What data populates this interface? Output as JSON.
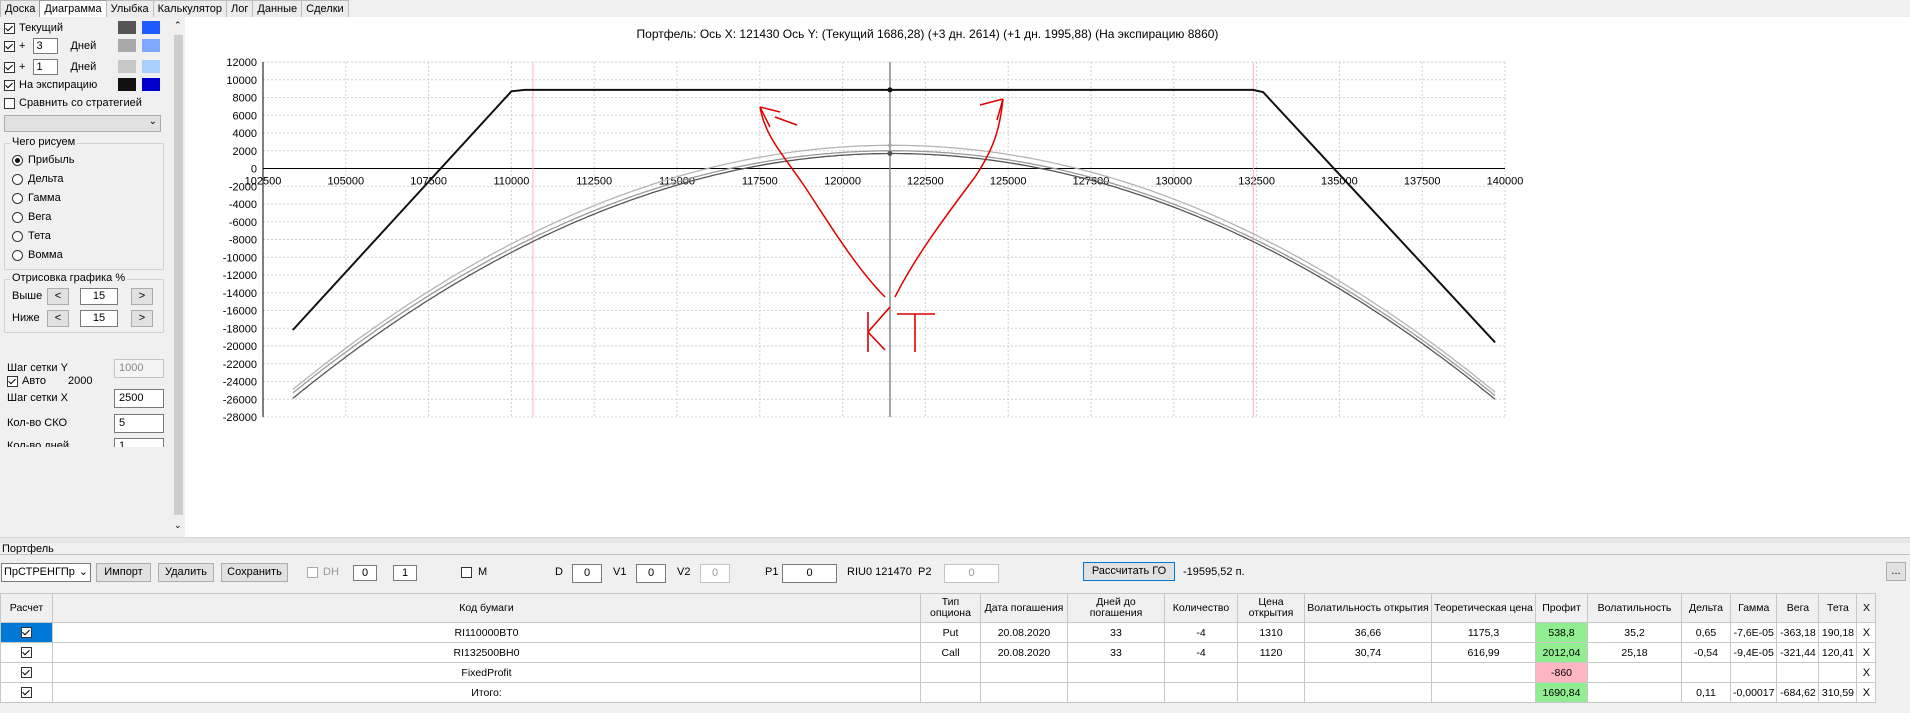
{
  "tabs": [
    "Доска",
    "Диаграмма",
    "Улыбка",
    "Калькулятор",
    "Лог",
    "Данные",
    "Сделки"
  ],
  "active_tab": 1,
  "left": {
    "current_label": "Текущий",
    "plus_label": "+",
    "days_label": "Дней",
    "days1": "3",
    "days2": "1",
    "expiry_label": "На экспирацию",
    "compare_label": "Сравнить со стратегией",
    "what_title": "Чего рисуем",
    "radios": [
      "Прибыль",
      "Дельта",
      "Гамма",
      "Вега",
      "Тета",
      "Вомма"
    ],
    "draw_title": "Отрисовка графика %",
    "above_label": "Выше",
    "below_label": "Ниже",
    "above_val": "15",
    "below_val": "15",
    "prev": "<",
    "next": ">",
    "gridy_label": "Шаг сетки Y",
    "gridy_val": "1000",
    "auto_label": "Авто",
    "auto_val": "2000",
    "gridx_label": "Шаг сетки X",
    "gridx_val": "2500",
    "sko_label": "Кол-во СКО",
    "sko_val": "5",
    "days_count_label": "Кол-во дней",
    "days_count_val": "1"
  },
  "colors": {
    "current": "#555555",
    "current2": "#1e5cff",
    "plus3": "#a8a8a8",
    "plus3b": "#7fa8ff",
    "plus1": "#c8c8c8",
    "plus1b": "#a8d0ff",
    "expiry": "#111111",
    "expiry2": "#0000cc",
    "annotation": "#e00000"
  },
  "chart_title": "Портфель: Ось X: 121430 Ось Y:  (Текущий 1686,28)  (+3 дн. 2614)  (+1 дн. 1995,88)  (На экспирацию 8860)",
  "annotation_text": "КТ",
  "chart_data": {
    "type": "line",
    "xlim": [
      102500,
      140000
    ],
    "ylim": [
      -28000,
      12000
    ],
    "x_ticks": [
      102500,
      105000,
      107500,
      110000,
      112500,
      115000,
      117500,
      120000,
      122500,
      125000,
      127500,
      130000,
      132500,
      135000,
      137500,
      140000
    ],
    "y_ticks": [
      12000,
      10000,
      8000,
      6000,
      4000,
      2000,
      0,
      -2000,
      -4000,
      -6000,
      -8000,
      -10000,
      -12000,
      -14000,
      -16000,
      -18000,
      -20000,
      -22000,
      -24000,
      -26000,
      -28000
    ],
    "cursor_x": 121430,
    "pink_lines": [
      110650,
      132400
    ],
    "series": [
      {
        "name": "На экспирацию",
        "color": "#111111",
        "points": [
          [
            103400,
            -18200
          ],
          [
            110000,
            8700
          ],
          [
            110400,
            8860
          ],
          [
            132400,
            8860
          ],
          [
            132700,
            8600
          ],
          [
            139700,
            -19600
          ]
        ]
      },
      {
        "name": "+3 дн.",
        "color": "#b5b5b5",
        "center": 121500,
        "peak": 2614,
        "ends": [
          [
            103400,
            -24900
          ],
          [
            139700,
            -25200
          ]
        ]
      },
      {
        "name": "+1 дн.",
        "color": "#9a9a9a",
        "center": 121500,
        "peak": 1995.88,
        "ends": [
          [
            103400,
            -25300
          ],
          [
            139700,
            -25600
          ]
        ]
      },
      {
        "name": "Текущий",
        "color": "#555555",
        "center": 121500,
        "peak": 1686.28,
        "ends": [
          [
            103400,
            -25900
          ],
          [
            139700,
            -26000
          ]
        ]
      }
    ]
  },
  "bottom": {
    "section": "Портфель",
    "strategy": "ПрСТРЕНГПр",
    "import": "Импорт",
    "delete": "Удалить",
    "save": "Сохранить",
    "dh": "DH",
    "dh_v1": "0",
    "dh_v2": "1",
    "m": "M",
    "d_label": "D",
    "d_val": "0",
    "v1_label": "V1",
    "v1_val": "0",
    "v2_label": "V2",
    "v2_val": "0",
    "p1_label": "P1",
    "p1_val": "0",
    "riu": "RIU0 121470",
    "p2_label": "P2",
    "p2_val": "0",
    "calc": "Рассчитать ГО",
    "go_value": "-19595,52 п.",
    "more": "..."
  },
  "table": {
    "headers": [
      "Расчет",
      "Код бумаги",
      "Тип опциона",
      "Дата погашения",
      "Дней до погашения",
      "Количество",
      "Цена открытия",
      "Волатильность открытия",
      "Теоретическая цена",
      "Профит",
      "Волатильность",
      "Дельта",
      "Гамма",
      "Вега",
      "Тета",
      "X"
    ],
    "rows": [
      [
        "",
        "RI110000BT0",
        "Put",
        "20.08.2020",
        "33",
        "-4",
        "1310",
        "36,66",
        "1175,3",
        "538,8",
        "35,2",
        "0,65",
        "-7,6E-05",
        "-363,18",
        "190,18",
        "X"
      ],
      [
        "",
        "RI132500BH0",
        "Call",
        "20.08.2020",
        "33",
        "-4",
        "1120",
        "30,74",
        "616,99",
        "2012,04",
        "25,18",
        "-0,54",
        "-9,4E-05",
        "-321,44",
        "120,41",
        "X"
      ],
      [
        "",
        "FixedProfit",
        "",
        "",
        "",
        "",
        "",
        "",
        "",
        "-860",
        "",
        "",
        "",
        "",
        "",
        "X"
      ],
      [
        "",
        "Итого:",
        "",
        "",
        "",
        "",
        "",
        "",
        "",
        "1690,84",
        "",
        "0,11",
        "-0,00017",
        "-684,62",
        "310,59",
        "X"
      ]
    ]
  }
}
